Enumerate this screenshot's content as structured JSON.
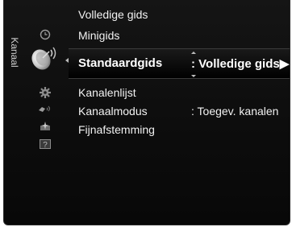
{
  "sidebar": {
    "title": "Kanaal",
    "icons": [
      "clock-icon",
      "satellite-dish-icon",
      "gear-icon",
      "input-plug-icon",
      "sparkle-app-icon",
      "help-icon"
    ],
    "active_icon": "satellite-dish-icon"
  },
  "menu": {
    "top_items": [
      {
        "label": "Volledige gids"
      },
      {
        "label": "Minigids"
      }
    ],
    "selected": {
      "label": "Standaardgids",
      "value": ": Volledige gids",
      "arrow": "▶"
    },
    "items": [
      {
        "label": "Kanalenlijst",
        "value": ""
      },
      {
        "label": "Kanaalmodus",
        "value": ": Toegev. kanalen"
      },
      {
        "label": "Fijnafstemming",
        "value": ""
      }
    ]
  },
  "colors": {
    "background": "#0d0d0d",
    "text": "#f2f2f2",
    "highlight_text": "#ffffff"
  }
}
